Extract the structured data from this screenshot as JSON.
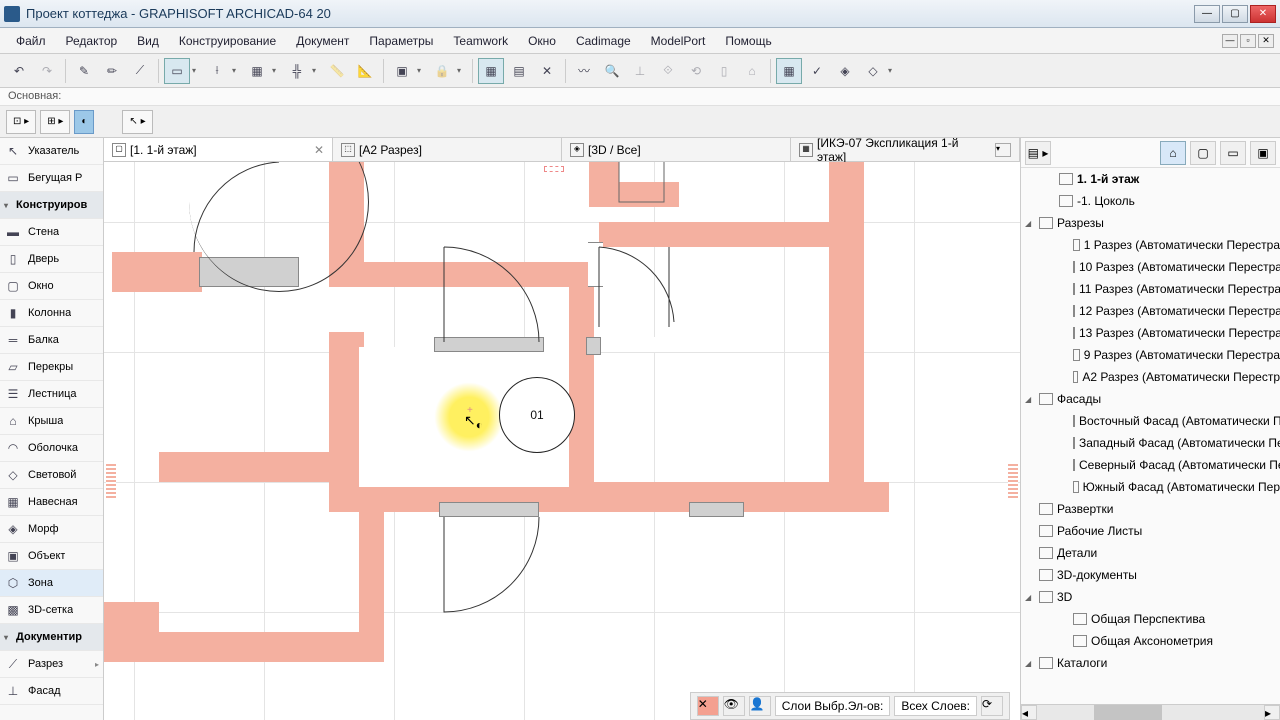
{
  "window": {
    "title": "Проект коттеджа - GRAPHISOFT ARCHICAD-64 20"
  },
  "menu": {
    "items": [
      "Файл",
      "Редактор",
      "Вид",
      "Конструирование",
      "Документ",
      "Параметры",
      "Teamwork",
      "Окно",
      "Cadimage",
      "ModelPort",
      "Помощь"
    ]
  },
  "label_row": "Основная:",
  "tabs": [
    {
      "label": "[1. 1-й этаж]",
      "active": true
    },
    {
      "label": "[А2 Разрез]",
      "active": false
    },
    {
      "label": "[3D / Все]",
      "active": false
    },
    {
      "label": "[ИКЭ-07 Экспликация 1-й этаж]",
      "active": false
    }
  ],
  "toolbox": {
    "arrow": "Указатель",
    "marquee": "Бегущая Р",
    "section_design": "Конструиров",
    "items": [
      "Стена",
      "Дверь",
      "Окно",
      "Колонна",
      "Балка",
      "Перекры",
      "Лестница",
      "Крыша",
      "Оболочка",
      "Световой",
      "Навесная",
      "Морф",
      "Объект",
      "Зона",
      "3D-сетка"
    ],
    "section_doc": "Документир",
    "doc_items": [
      "Разрез",
      "Фасад"
    ]
  },
  "zone": {
    "label": "01"
  },
  "navigator": {
    "floor1": "1. 1-й этаж",
    "floor_neg1": "-1. Цоколь",
    "sections_header": "Разрезы",
    "sections": [
      "1 Разрез (Автоматически Перестра",
      "10 Разрез (Автоматически Перестра",
      "11 Разрез (Автоматически Перестра",
      "12 Разрез (Автоматически Перестра",
      "13 Разрез (Автоматически Перестра",
      "9 Разрез (Автоматически Перестра",
      "А2 Разрез (Автоматически Перестр"
    ],
    "facades_header": "Фасады",
    "facades": [
      "Восточный Фасад (Автоматически П",
      "Западный Фасад (Автоматически Пе",
      "Северный Фасад (Автоматически Пе",
      "Южный Фасад (Автоматически Пер"
    ],
    "razvertki": "Развертки",
    "worksheets": "Рабочие Листы",
    "details": "Детали",
    "docs3d": "3D-документы",
    "header3d": "3D",
    "items3d": [
      "Общая Перспектива",
      "Общая Аксонометрия"
    ],
    "catalogs": "Каталоги"
  },
  "bottom": {
    "layer1": "Слои Выбр.Эл-ов:",
    "layer2": "Всех Слоев:"
  }
}
